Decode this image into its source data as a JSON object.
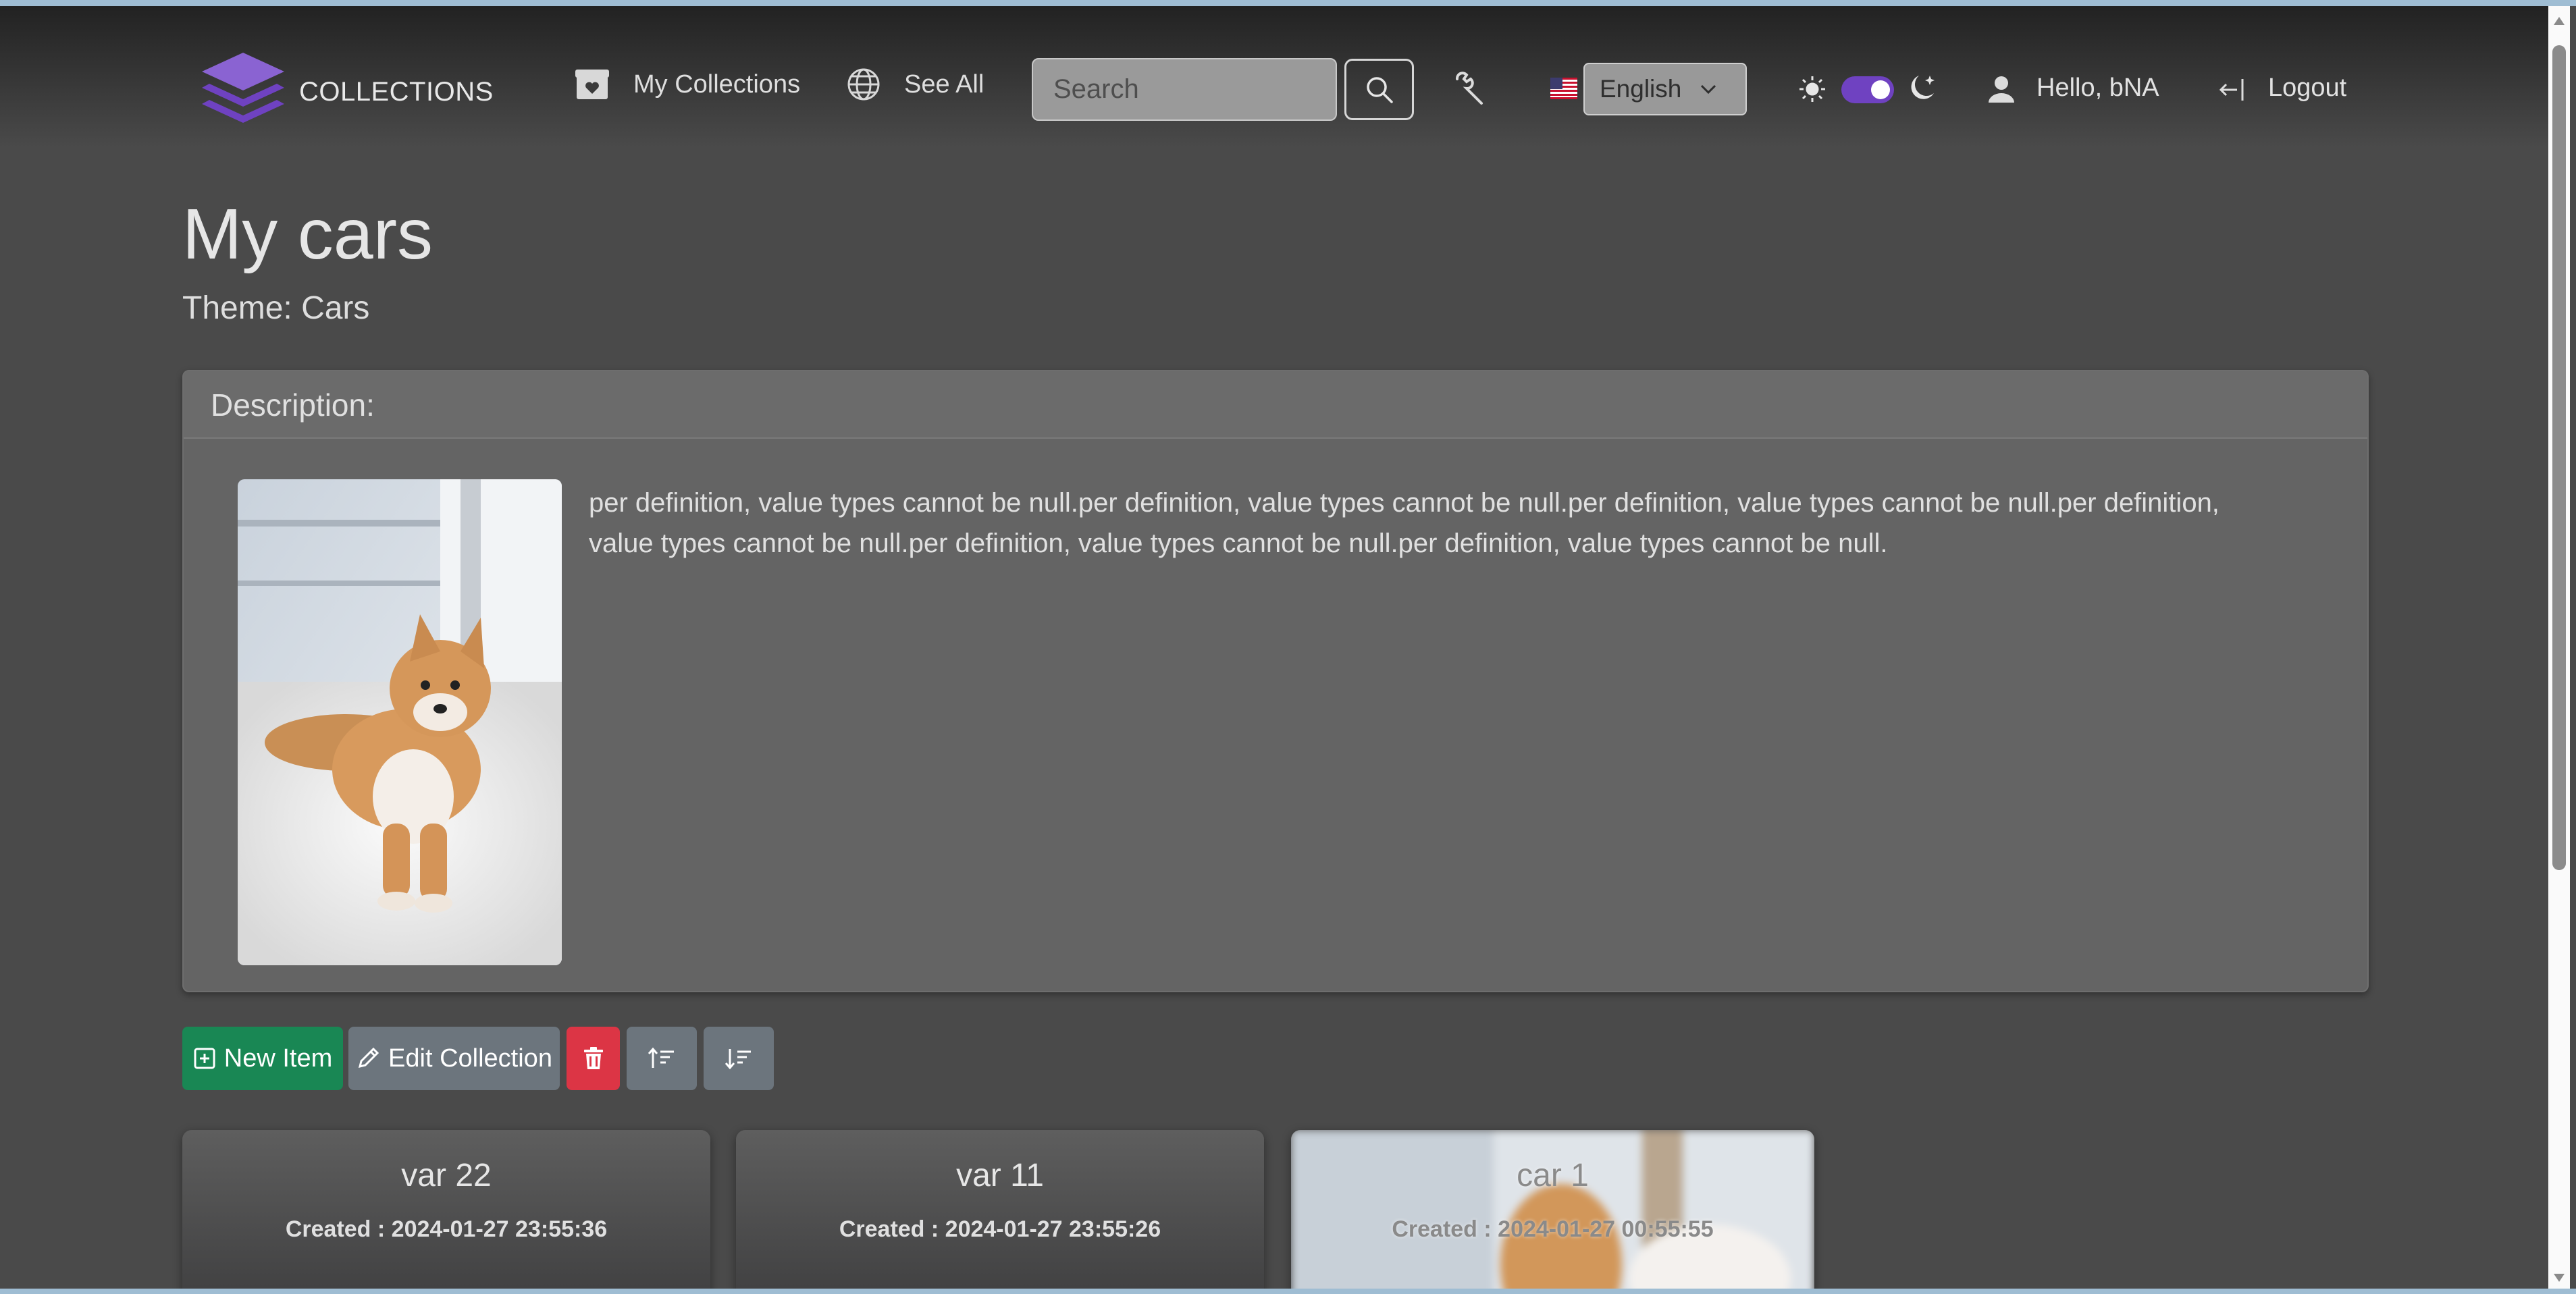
{
  "navbar": {
    "brand": "COLLECTIONS",
    "my_collections": "My Collections",
    "see_all": "See All",
    "search_placeholder": "Search",
    "language": "English",
    "greeting": "Hello, bNA",
    "logout": "Logout",
    "theme_toggle_on": true,
    "accent_color": "#6f42c1"
  },
  "collection": {
    "title": "My cars",
    "theme_line": "Theme: Cars",
    "description_header": "Description:",
    "description": "per definition, value types cannot be null.per definition, value types cannot be null.per definition, value types cannot be null.per definition, value types cannot be null.per definition, value types cannot be null.per definition, value types cannot be null."
  },
  "actions": {
    "new_item": "New Item",
    "edit_collection": "Edit Collection"
  },
  "items": [
    {
      "title": "var 22",
      "created": "Created : 2024-01-27 23:55:36"
    },
    {
      "title": "var 11",
      "created": "Created : 2024-01-27 23:55:26"
    },
    {
      "title": "car 1",
      "created": "Created : 2024-01-27 00:55:55"
    }
  ]
}
